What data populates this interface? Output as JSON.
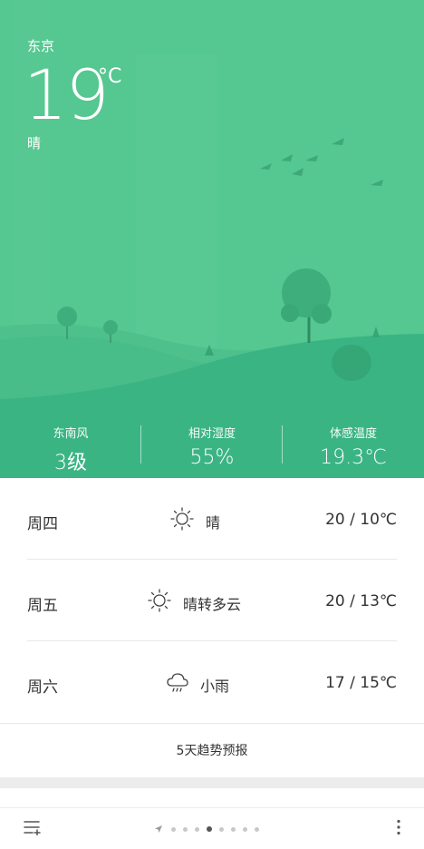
{
  "current": {
    "city": "东京",
    "temperature": "19",
    "unit": "°C",
    "condition": "晴"
  },
  "stats": [
    {
      "label": "东南风",
      "value": "3级"
    },
    {
      "label": "相对湿度",
      "value": "55%"
    },
    {
      "label": "体感温度",
      "value": "19.3℃"
    }
  ],
  "forecast": [
    {
      "day": "周四",
      "icon": "sun-icon",
      "condition": "晴",
      "range": "20 / 10℃"
    },
    {
      "day": "周五",
      "icon": "sun-icon",
      "condition": "晴转多云",
      "range": "20 / 13℃"
    },
    {
      "day": "周六",
      "icon": "cloud-rain-icon",
      "condition": "小雨",
      "range": "17 / 15℃"
    }
  ],
  "trend_label": "5天趋势预报",
  "pager": {
    "pages": 9,
    "active_index": 7
  },
  "colors": {
    "sky": "#55c790",
    "hill_front": "#3bb484",
    "text": "#333333"
  }
}
